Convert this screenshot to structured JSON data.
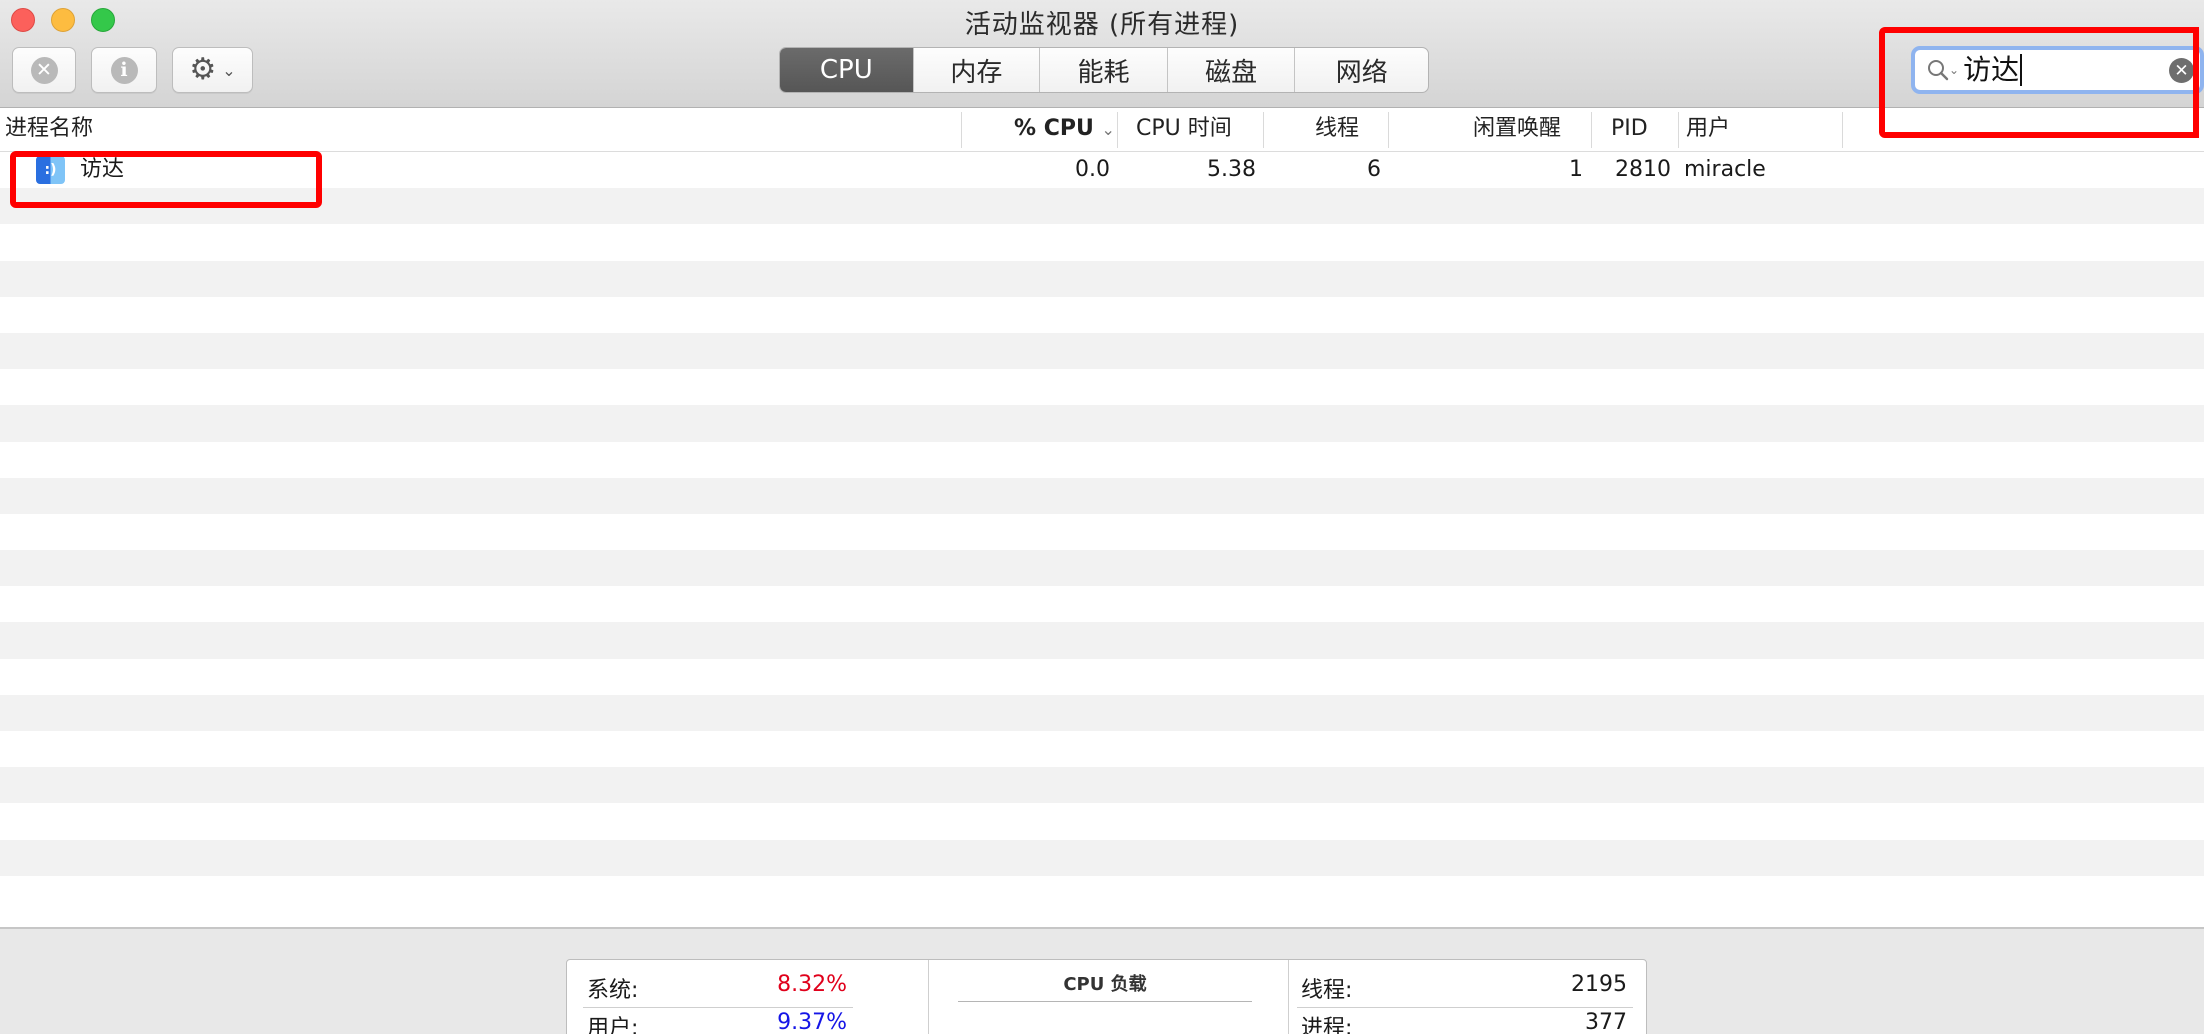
{
  "window": {
    "title": "活动监视器 (所有进程)"
  },
  "toolbar": {
    "stop_glyph": "✕",
    "info_glyph": "i",
    "gear_glyph": "⚙",
    "gear_chevron": "⌄"
  },
  "tabs": [
    {
      "label": "CPU",
      "active": true
    },
    {
      "label": "内存",
      "active": false
    },
    {
      "label": "能耗",
      "active": false
    },
    {
      "label": "磁盘",
      "active": false
    },
    {
      "label": "网络",
      "active": false
    }
  ],
  "search": {
    "value": "访达",
    "icon": "search-icon",
    "clear_glyph": "✕"
  },
  "table": {
    "columns": {
      "name": "进程名称",
      "cpu_pct": "% CPU",
      "cpu_time": "CPU 时间",
      "threads": "线程",
      "idle_wakeups": "闲置唤醒",
      "pid": "PID",
      "user": "用户"
    },
    "sort_indicator": "⌄",
    "rows": [
      {
        "icon": "finder-icon",
        "name": "访达",
        "cpu_pct": "0.0",
        "cpu_time": "5.38",
        "threads": "6",
        "idle_wakeups": "1",
        "pid": "2810",
        "user": "miracle"
      }
    ]
  },
  "footer": {
    "system_label": "系统:",
    "system_value": "8.32%",
    "user_label": "用户:",
    "user_value": "9.37%",
    "cpu_load_label": "CPU 负载",
    "threads_label": "线程:",
    "threads_value": "2195",
    "processes_label": "进程:",
    "processes_value": "377"
  },
  "colors": {
    "system_value": "#e0001b",
    "user_value": "#1515e6",
    "annotation": "#ff0000"
  }
}
